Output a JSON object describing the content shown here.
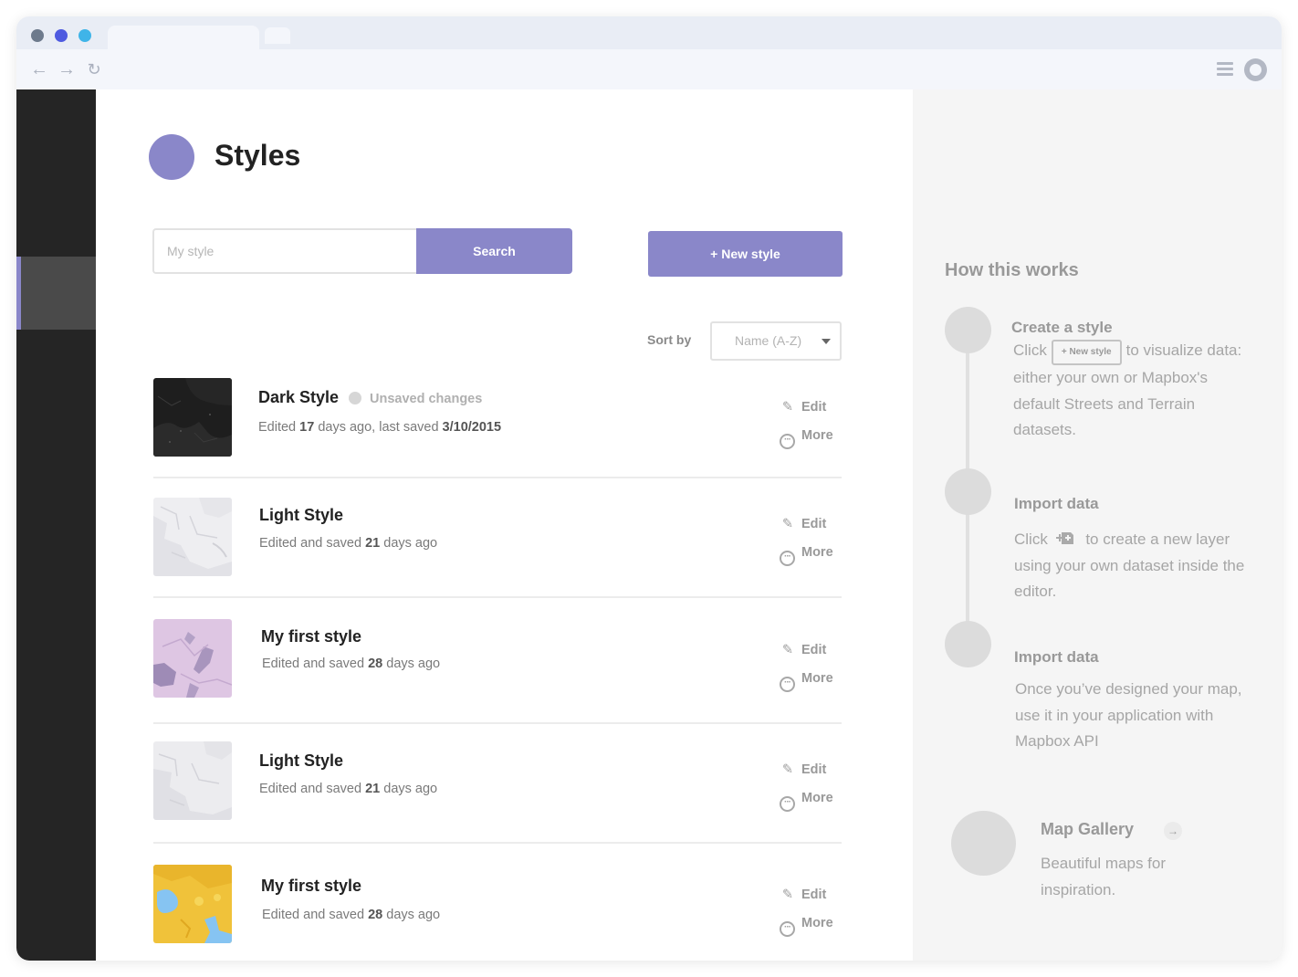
{
  "browser": {
    "dot_colors": [
      "#6d7a8c",
      "#4e5ae0",
      "#3fb4e8"
    ]
  },
  "header": {
    "title": "Styles"
  },
  "search": {
    "placeholder": "My style",
    "button_label": "Search"
  },
  "new_style_label": "+ New style",
  "sort": {
    "label": "Sort by",
    "value": "Name (A-Z)"
  },
  "styles": [
    {
      "name": "Dark Style",
      "status": "Unsaved changes",
      "meta_prefix": "Edited ",
      "meta_bold1": "17",
      "meta_mid": " days ago, last saved ",
      "meta_bold2": "3/10/2015",
      "meta_suffix": "",
      "edit_label": "Edit",
      "more_label": "More"
    },
    {
      "name": "Light Style",
      "meta_prefix": "Edited and saved ",
      "meta_bold1": "21",
      "meta_mid": " days ago",
      "edit_label": "Edit",
      "more_label": "More"
    },
    {
      "name": "My first style",
      "meta_prefix": "Edited and saved ",
      "meta_bold1": "28",
      "meta_mid": " days ago",
      "edit_label": "Edit",
      "more_label": "More"
    },
    {
      "name": "Light Style",
      "meta_prefix": "Edited and saved ",
      "meta_bold1": "21",
      "meta_mid": " days ago",
      "edit_label": "Edit",
      "more_label": "More"
    },
    {
      "name": "My first style",
      "meta_prefix": "Edited and saved ",
      "meta_bold1": "28",
      "meta_mid": " days ago",
      "edit_label": "Edit",
      "more_label": "More"
    }
  ],
  "help": {
    "title": "How this works",
    "steps": [
      {
        "title": "Create a style",
        "text_before": "Click",
        "inline_button": "+ New style",
        "text_after": "to visualize data: either your own or Mapbox's default Streets and Terrain datasets."
      },
      {
        "title": "Import data",
        "text_before": "Click",
        "inline_icon": "add-layer-icon",
        "text_after": "to create a new layer using your own dataset inside the editor."
      },
      {
        "title": "Import data",
        "text": "Once you’ve designed your map, use it in your application with Mapbox API"
      }
    ],
    "gallery": {
      "title": "Map Gallery",
      "text": "Beautiful maps for inspiration."
    }
  },
  "colors": {
    "accent": "#8a87c9",
    "sidebar": "#252525"
  }
}
